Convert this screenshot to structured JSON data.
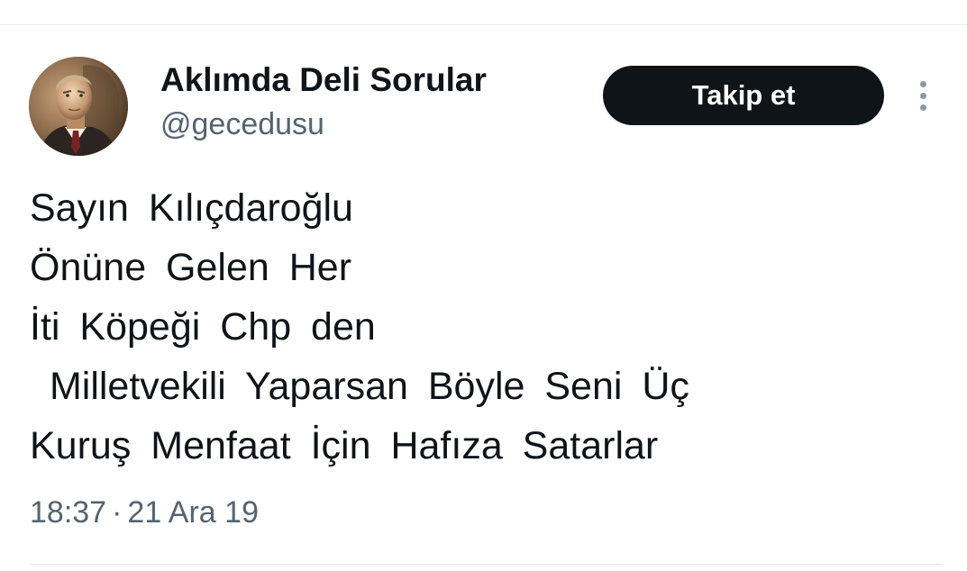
{
  "author": {
    "display_name": "Aklımda Deli Sorular",
    "handle": "@gecedusu",
    "avatar_icon": "portrait-avatar"
  },
  "follow_button": {
    "label": "Takip et"
  },
  "more_menu": {
    "icon": "more-vertical-icon"
  },
  "tweet": {
    "lines": [
      "Sayın Kılıçdaroğlu",
      "Önüne Gelen Her",
      "İti Köpeği Chp den",
      " Milletvekili Yaparsan Böyle Seni Üç",
      "Kuruş Menfaat İçin Hafıza Satarlar"
    ]
  },
  "meta": {
    "time": "18:37",
    "separator": "·",
    "date": "21 Ara 19"
  },
  "colors": {
    "text_primary": "#0f1419",
    "text_secondary": "#536471",
    "button_bg": "#0f1419",
    "button_text": "#ffffff",
    "divider": "#e6e9ec"
  }
}
